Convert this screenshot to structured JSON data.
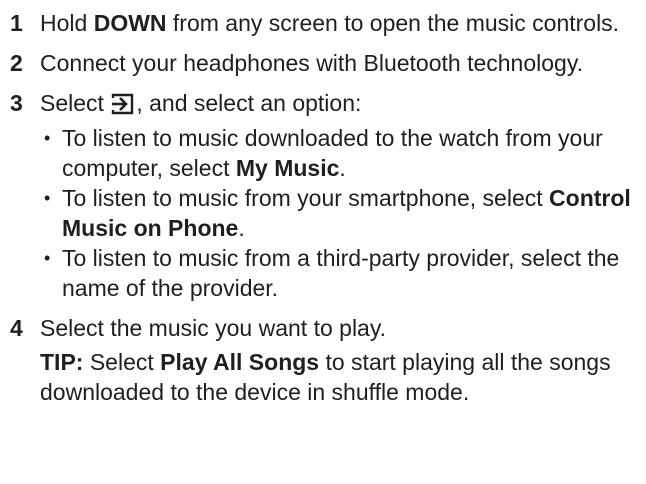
{
  "steps": [
    {
      "number": "1",
      "pre": "Hold ",
      "bold": "DOWN",
      "post": " from any screen to open the music controls."
    },
    {
      "number": "2",
      "text": "Connect your headphones with Bluetooth technology."
    },
    {
      "number": "3",
      "pre": "Select ",
      "icon": "arrow-into-bracket-icon",
      "post": ", and select an option:",
      "bullets": [
        {
          "pre": "To listen to music downloaded to the watch from your computer, select ",
          "bold": "My Music",
          "post": "."
        },
        {
          "pre": "To listen to music from your smartphone, select ",
          "bold": "Control Music on Phone",
          "post": "."
        },
        {
          "pre": "To listen to music from a third-party provider, select the name of the provider.",
          "bold": "",
          "post": ""
        }
      ]
    },
    {
      "number": "4",
      "text": "Select the music you want to play."
    }
  ],
  "tip": {
    "label": "TIP:",
    "pre": " Select ",
    "bold": "Play All Songs",
    "post": " to start playing all the songs downloaded to the device in shuffle mode."
  },
  "bullet_char": "•"
}
